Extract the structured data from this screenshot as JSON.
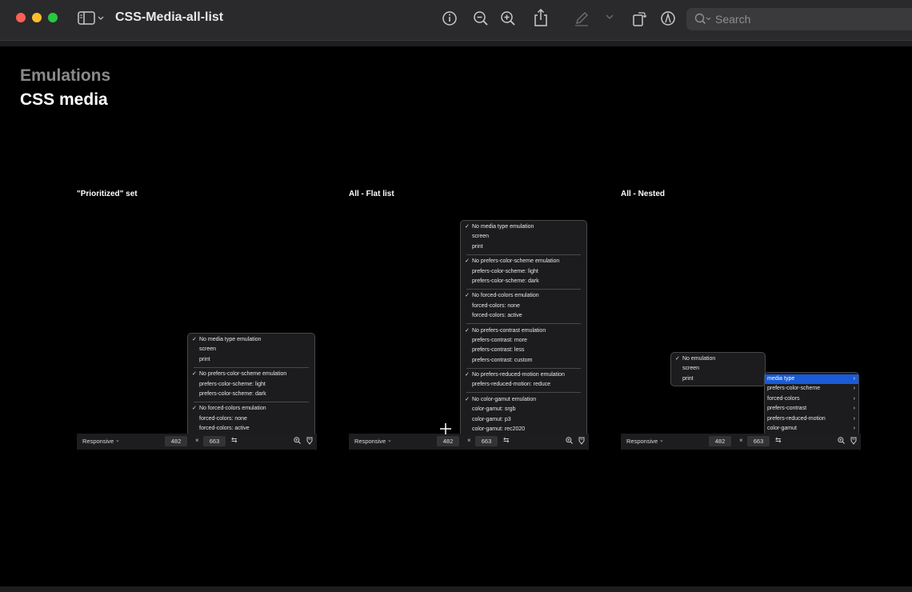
{
  "window": {
    "title": "CSS-Media-all-list",
    "search_placeholder": "Search"
  },
  "headings": {
    "section": "Emulations",
    "title": "CSS media"
  },
  "columns": [
    {
      "label": "\"Prioritized\" set"
    },
    {
      "label": "All - Flat list"
    },
    {
      "label": "All - Nested"
    }
  ],
  "toolbar": {
    "device": "Responsive",
    "width": "482",
    "height": "663",
    "times": "×"
  },
  "prioritized_menu": {
    "groups": [
      [
        "No media type emulation",
        "screen",
        "print"
      ],
      [
        "No prefers-color-scheme emulation",
        "prefers-color-scheme: light",
        "prefers-color-scheme: dark"
      ],
      [
        "No forced-colors emulation",
        "forced-colors: none",
        "forced-colors: active"
      ]
    ]
  },
  "flat_menu": {
    "groups": [
      [
        "No media type emulation",
        "screen",
        "print"
      ],
      [
        "No prefers-color-scheme emulation",
        "prefers-color-scheme: light",
        "prefers-color-scheme: dark"
      ],
      [
        "No forced-colors emulation",
        "forced-colors: none",
        "forced-colors: active"
      ],
      [
        "No prefers-contrast emulation",
        "prefers-contrast: more",
        "prefers-contrast: less",
        "prefers-contrast: custom"
      ],
      [
        "No prefers-reduced-motion emulation",
        "prefers-reduced-motion: reduce"
      ],
      [
        "No color-gamut emulation",
        "color-gamut: srgb",
        "color-gamut: p3",
        "color-gamut: rec2020"
      ]
    ]
  },
  "nested_menu": {
    "items": [
      "No emulation",
      "screen",
      "print"
    ],
    "submenu": [
      "media type",
      "prefers-color-scheme",
      "forced-colors",
      "prefers-contrast",
      "prefers-reduced-motion",
      "color-gamut"
    ],
    "highlighted": "media type",
    "highlight_color": "#1a5bd6"
  }
}
